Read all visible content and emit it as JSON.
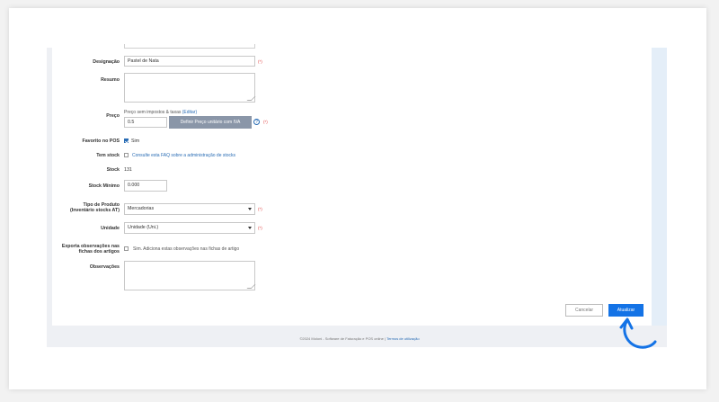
{
  "form": {
    "designacao": {
      "label": "Designação",
      "value": "Pastel de Nata",
      "required": "(*)"
    },
    "resumo": {
      "label": "Resumo"
    },
    "preco": {
      "label": "Preço",
      "hint": "Preço sem impostos & taxas",
      "edit_link": "(Editar)",
      "value": "0.5",
      "define_button": "Definir Preço unitário com IVA",
      "help_icon": "?",
      "required": "(*)"
    },
    "favorito": {
      "label": "Favorito no POS",
      "checked": true,
      "option": "Sim"
    },
    "tem_stock": {
      "label": "Tem stock",
      "checked": false,
      "link": "Consulte esta FAQ sobre a administração de stocks"
    },
    "stock": {
      "label": "Stock",
      "value": "131"
    },
    "stock_minimo": {
      "label": "Stock Mínimo",
      "value": "0.000"
    },
    "tipo_produto": {
      "label_line1": "Tipo de Produto",
      "label_line2": "(Inventário stocks AT)",
      "selected": "Mercadorias",
      "required": "(*)"
    },
    "unidade": {
      "label": "Unidade",
      "selected": "Unidade (Uni.)",
      "required": "(*)"
    },
    "exporta_obs": {
      "label_line1": "Exporta observações nas",
      "label_line2": "fichas dos artigos",
      "checked": false,
      "option": "Sim. Adiciona estas observações nas fichas de artigo"
    },
    "observacoes": {
      "label": "Observações"
    }
  },
  "actions": {
    "cancel_label": "Cancelar",
    "update_label": "Atualizar"
  },
  "footer": {
    "copyright": "©2024 Moloni - Software de Faturação e POS online |",
    "terms_link": "Termos de utilização"
  },
  "colors": {
    "primary": "#1473e6",
    "link": "#2a6db5",
    "required": "#e04545",
    "define_button": "#8a96a8"
  },
  "icons": {
    "pointer": "curved-arrow-pointer-icon",
    "help": "question-circle-icon",
    "checkbox": "checkbox-icon",
    "caret": "chevron-down-icon"
  }
}
